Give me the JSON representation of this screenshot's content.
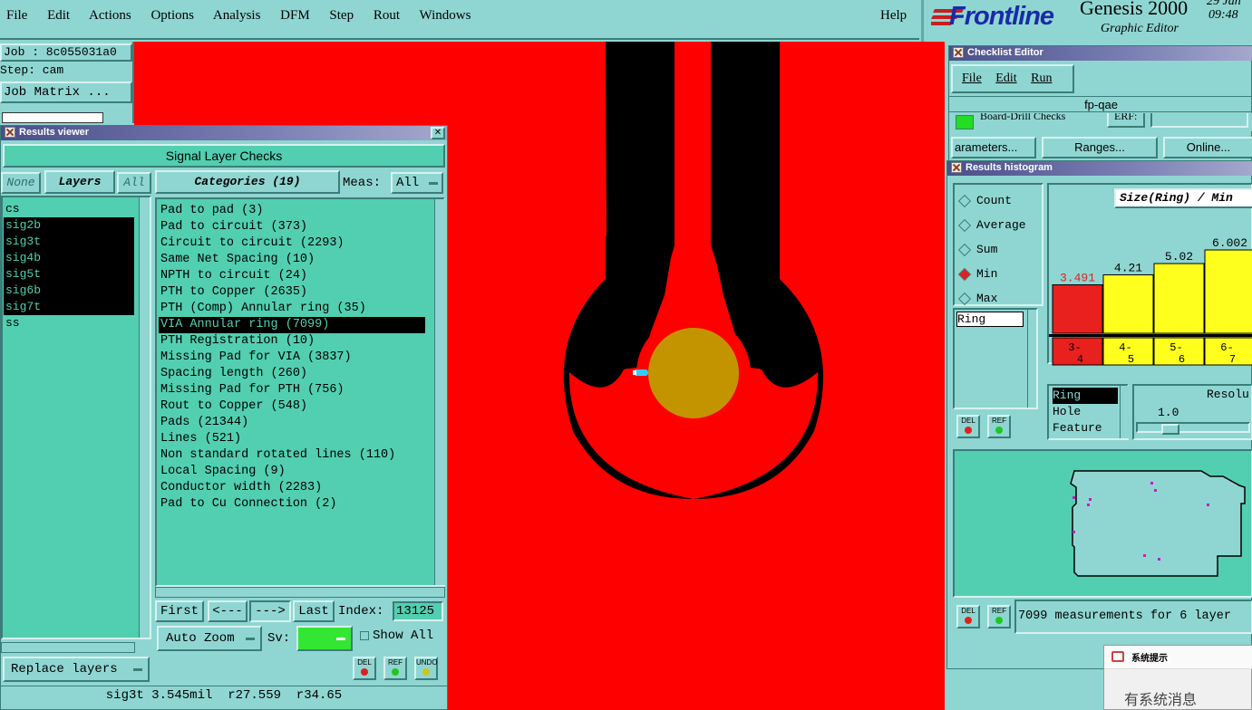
{
  "menubar": {
    "items": [
      "File",
      "Edit",
      "Actions",
      "Options",
      "Analysis",
      "DFM",
      "Step",
      "Rout",
      "Windows"
    ],
    "help": "Help"
  },
  "brand": {
    "logo": "Frontline",
    "product": "Genesis 2000",
    "subtitle": "Graphic Editor",
    "date": "29 Jan",
    "time": "09:48"
  },
  "job_panel": {
    "job": "Job : 8c055031a0",
    "step": "Step: cam",
    "matrix_button": "Job Matrix ..."
  },
  "results_viewer": {
    "title": "Results viewer",
    "header": "Signal Layer Checks",
    "btn_none": "None",
    "btn_layers": "Layers",
    "btn_all": "All",
    "layers": [
      {
        "name": "cs",
        "selected": false
      },
      {
        "name": "sig2b",
        "selected": true
      },
      {
        "name": "sig3t",
        "selected": true
      },
      {
        "name": "sig4b",
        "selected": true
      },
      {
        "name": "sig5t",
        "selected": true
      },
      {
        "name": "sig6b",
        "selected": true
      },
      {
        "name": "sig7t",
        "selected": true
      },
      {
        "name": "ss",
        "selected": false
      }
    ],
    "categories_button": "Categories (19)",
    "meas_label": "Meas:",
    "meas_value": "All",
    "categories": [
      {
        "label": "Pad to pad (3)",
        "selected": false
      },
      {
        "label": "Pad to circuit (373)",
        "selected": false
      },
      {
        "label": "Circuit to circuit (2293)",
        "selected": false
      },
      {
        "label": "Same Net Spacing (10)",
        "selected": false
      },
      {
        "label": "NPTH to circuit (24)",
        "selected": false
      },
      {
        "label": "PTH to Copper (2635)",
        "selected": false
      },
      {
        "label": "PTH (Comp) Annular ring (35)",
        "selected": false
      },
      {
        "label": "VIA Annular ring (7099)",
        "selected": true
      },
      {
        "label": "PTH Registration (10)",
        "selected": false
      },
      {
        "label": "Missing Pad for VIA (3837)",
        "selected": false
      },
      {
        "label": "Spacing length (260)",
        "selected": false
      },
      {
        "label": "Missing Pad for PTH (756)",
        "selected": false
      },
      {
        "label": "Rout to Copper (548)",
        "selected": false
      },
      {
        "label": "Pads (21344)",
        "selected": false
      },
      {
        "label": "Lines (521)",
        "selected": false
      },
      {
        "label": "Non standard rotated lines (110)",
        "selected": false
      },
      {
        "label": "Local Spacing (9)",
        "selected": false
      },
      {
        "label": "Conductor width (2283)",
        "selected": false
      },
      {
        "label": "Pad to Cu Connection (2)",
        "selected": false
      }
    ],
    "nav": {
      "first": "First",
      "prev": "<---",
      "next": "--->",
      "last": "Last",
      "index_label": "Index:",
      "index_value": "13125"
    },
    "auto_zoom": "Auto Zoom",
    "sv_label": "Sv:",
    "show_all": "Show All",
    "replace_layers": "Replace layers",
    "status": "sig3t 3.545mil  r27.559  r34.65",
    "btn_del": "DEL",
    "btn_ref": "REF",
    "btn_undo": "UNDO"
  },
  "checklist_editor": {
    "title": "Checklist Editor",
    "menu": [
      "File",
      "Edit",
      "Run"
    ],
    "name": "fp-qae",
    "row_text": "Board-Drill Checks",
    "row_erf": "ERF:",
    "btn_parameters": "arameters...",
    "btn_ranges": "Ranges...",
    "btn_online": "Online..."
  },
  "histogram": {
    "title": "Results histogram",
    "modes": [
      {
        "label": "Count",
        "selected": false
      },
      {
        "label": "Average",
        "selected": false
      },
      {
        "label": "Sum",
        "selected": false
      },
      {
        "label": "Min",
        "selected": true
      },
      {
        "label": "Max",
        "selected": false
      }
    ],
    "chart_title": "Size(Ring) / Min",
    "bars": [
      {
        "value": "3.491",
        "range": "3- 4",
        "color": "#e8201e"
      },
      {
        "value": "4.21",
        "range": "4- 5",
        "color": "#ffff1e"
      },
      {
        "value": "5.02",
        "range": "5- 6",
        "color": "#ffff1e"
      },
      {
        "value": "6.002",
        "range": "6- 7",
        "color": "#ffff1e"
      }
    ],
    "attr_list": [
      "Ring"
    ],
    "fields": [
      "Ring",
      "Hole",
      "Feature"
    ],
    "resolution_label": "Resolu",
    "resolution_value": "1.0",
    "summary": "7099 measurements for 6 layer"
  },
  "popup": {
    "title": "系统提示",
    "message": "有系统消息"
  },
  "colors": {
    "board_bg": "#ff0000",
    "copper": "#000000",
    "pad": "#c39400",
    "marker": "#33ccff",
    "panel": "#8fd6d2",
    "list_bg": "#52cfb0"
  }
}
